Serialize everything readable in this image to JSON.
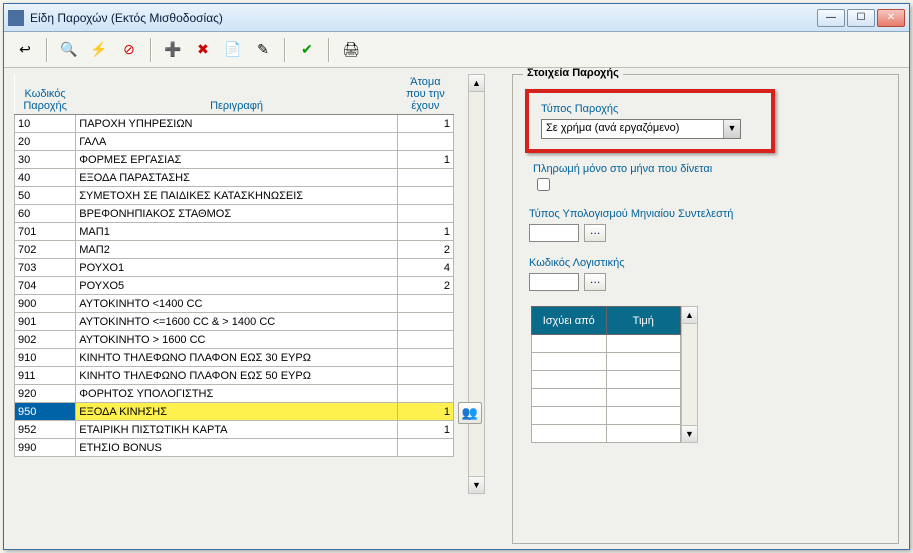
{
  "window": {
    "title": "Είδη Παροχών (Εκτός Μισθοδοσίας)"
  },
  "toolbar_icons": {
    "exit": "↩",
    "search": "🔍",
    "refresh": "⚡",
    "cancel": "⊘",
    "add": "➕",
    "delete": "✖",
    "copy": "📄",
    "edit": "✎",
    "confirm": "✔",
    "print": "🖨"
  },
  "grid": {
    "headers": {
      "code": "Κωδικός Παροχής",
      "desc": "Περιγραφή",
      "count": "Άτομα που την έχουν"
    },
    "rows": [
      {
        "code": "10",
        "desc": "ΠΑΡΟΧΗ ΥΠΗΡΕΣΙΩΝ",
        "count": "1"
      },
      {
        "code": "20",
        "desc": "ΓΑΛΑ",
        "count": ""
      },
      {
        "code": "30",
        "desc": "ΦΟΡΜΕΣ ΕΡΓΑΣΙΑΣ",
        "count": "1"
      },
      {
        "code": "40",
        "desc": "ΕΞΟΔΑ ΠΑΡΑΣΤΑΣΗΣ",
        "count": ""
      },
      {
        "code": "50",
        "desc": "ΣΥΜΕΤΟΧΗ ΣΕ ΠΑΙΔΙΚΕΣ ΚΑΤΑΣΚΗΝΩΣΕΙΣ",
        "count": ""
      },
      {
        "code": "60",
        "desc": "ΒΡΕΦΟΝΗΠΙΑΚΟΣ ΣΤΑΘΜΟΣ",
        "count": ""
      },
      {
        "code": "701",
        "desc": "ΜΑΠ1",
        "count": "1"
      },
      {
        "code": "702",
        "desc": "ΜΑΠ2",
        "count": "2"
      },
      {
        "code": "703",
        "desc": "ΡΟΥΧΟ1",
        "count": "4"
      },
      {
        "code": "704",
        "desc": "ΡΟΥΧΟ5",
        "count": "2"
      },
      {
        "code": "900",
        "desc": "ΑΥΤΟΚΙΝΗΤΟ <1400 CC",
        "count": ""
      },
      {
        "code": "901",
        "desc": "ΑΥΤΟΚΙΝΗΤΟ <=1600 CC & > 1400 CC",
        "count": ""
      },
      {
        "code": "902",
        "desc": "ΑΥΤΟΚΙΝΗΤΟ  > 1600 CC",
        "count": ""
      },
      {
        "code": "910",
        "desc": "ΚΙΝΗΤΟ ΤΗΛΕΦΩΝΟ ΠΛΑΦΟΝ ΕΩΣ 30 ΕΥΡΩ",
        "count": ""
      },
      {
        "code": "911",
        "desc": "ΚΙΝΗΤΟ ΤΗΛΕΦΩΝΟ ΠΛΑΦΟΝ ΕΩΣ 50 ΕΥΡΩ",
        "count": ""
      },
      {
        "code": "920",
        "desc": "ΦΟΡΗΤΟΣ ΥΠΟΛΟΓΙΣΤΗΣ",
        "count": ""
      },
      {
        "code": "950",
        "desc": "ΕΞΟΔΑ ΚΙΝΗΣΗΣ",
        "count": "1",
        "selected": true
      },
      {
        "code": "952",
        "desc": "ΕΤΑΙΡΙΚΗ ΠΙΣΤΩΤΙΚΗ ΚΑΡΤΑ",
        "count": "1"
      },
      {
        "code": "990",
        "desc": "ΕΤΗΣΙΟ BONUS",
        "count": ""
      }
    ]
  },
  "details": {
    "legend": "Στοιχεία Παροχής",
    "type_label": "Τύπος Παροχής",
    "type_value": "Σε χρήμα (ανά εργαζόμενο)",
    "pay_only_label": "Πληρωμή μόνο στο μήνα που δίνεται",
    "pay_only_checked": false,
    "monthly_coef_label": "Τύπος Υπολογισμού Μηνιαίου Συντελεστή",
    "monthly_coef_value": "",
    "accounting_code_label": "Κωδικός Λογιστικής",
    "accounting_code_value": "",
    "rate_headers": {
      "from": "Ισχύει από",
      "value": "Τιμή"
    }
  }
}
